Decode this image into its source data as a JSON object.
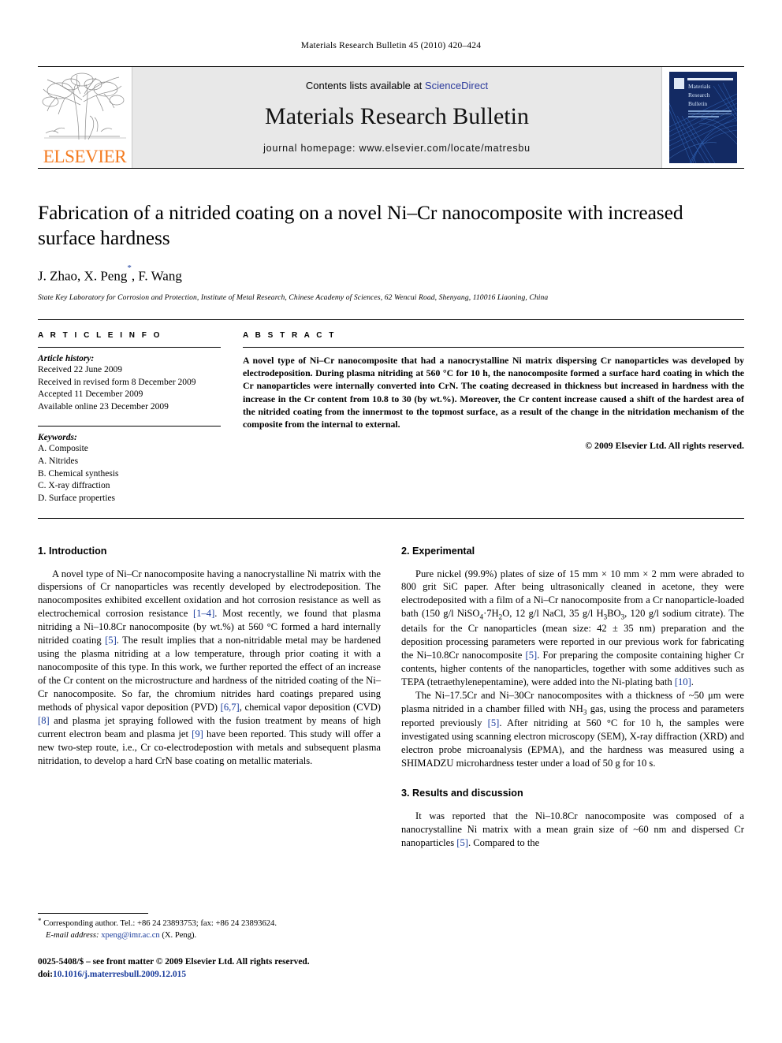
{
  "running_head": "Materials Research Bulletin 45 (2010) 420–424",
  "masthead": {
    "publisher_name": "ELSEVIER",
    "contents_prefix": "Contents lists available at ",
    "contents_link": "ScienceDirect",
    "journal_title": "Materials Research Bulletin",
    "homepage": "journal homepage: www.elsevier.com/locate/matresbu",
    "cover": {
      "line1": "Materials",
      "line2": "Research",
      "line3": "Bulletin"
    },
    "link_color": "#2b3a9c",
    "brand_color": "#F47B20"
  },
  "article": {
    "title": "Fabrication of a nitrided coating on a novel Ni–Cr nanocomposite with increased surface hardness",
    "authors_pre": "J. Zhao, X. Peng",
    "authors_star": "*",
    "authors_post": ", F. Wang",
    "affiliation": "State Key Laboratory for Corrosion and Protection, Institute of Metal Research, Chinese Academy of Sciences, 62 Wencui Road, Shenyang, 110016 Liaoning, China"
  },
  "info": {
    "heading": "A R T I C L E   I N F O",
    "history_title": "Article history:",
    "history": [
      "Received 22 June 2009",
      "Received in revised form 8 December 2009",
      "Accepted 11 December 2009",
      "Available online 23 December 2009"
    ],
    "keywords_title": "Keywords:",
    "keywords": [
      "A. Composite",
      "A. Nitrides",
      "B. Chemical synthesis",
      "C. X-ray diffraction",
      "D. Surface properties"
    ]
  },
  "abstract": {
    "heading": "A B S T R A C T",
    "text": "A novel type of Ni–Cr nanocomposite that had a nanocrystalline Ni matrix dispersing Cr nanoparticles was developed by electrodeposition. During plasma nitriding at 560 °C for 10 h, the nanocomposite formed a surface hard coating in which the Cr nanoparticles were internally converted into CrN. The coating decreased in thickness but increased in hardness with the increase in the Cr content from 10.8 to 30 (by wt.%). Moreover, the Cr content increase caused a shift of the hardest area of the nitrided coating from the innermost to the topmost surface, as a result of the change in the nitridation mechanism of the composite from the internal to external.",
    "copyright": "© 2009 Elsevier Ltd. All rights reserved."
  },
  "sections": {
    "introduction": {
      "heading": "1. Introduction",
      "p1_a": "A novel type of Ni–Cr nanocomposite having a nanocrystalline Ni matrix with the dispersions of Cr nanoparticles was recently developed by electrodeposition. The nanocomposites exhibited excellent oxidation and hot corrosion resistance as well as electrochemical corrosion resistance ",
      "c1": "[1–4]",
      "p1_b": ". Most recently, we found that plasma nitriding a Ni–10.8Cr nanocomposite (by wt.%) at 560 °C formed a hard internally nitrided coating ",
      "c2": "[5]",
      "p1_c": ". The result implies that a non-nitridable metal may be hardened using the plasma nitriding at a low temperature, through prior coating it with a nanocomposite of this type. In this work, we further reported the effect of an increase of the Cr content on the microstructure and hardness of the nitrided coating of the Ni–Cr nanocomposite. So far, the chromium nitrides hard coatings prepared using methods of physical vapor deposition (PVD) ",
      "c3": "[6,7]",
      "p1_d": ", chemical vapor deposition (CVD) ",
      "c4": "[8]",
      "p1_e": " and plasma jet spraying followed with the fusion treatment by means of high current electron beam and plasma jet ",
      "c5": "[9]",
      "p1_f": " have been reported. This study will offer a new two-step route, i.e., Cr co-electrodepostion with metals and subsequent plasma nitridation, to develop a hard CrN base coating on metallic materials."
    },
    "experimental": {
      "heading": "2. Experimental",
      "p1_a": "Pure nickel (99.9%) plates of size of 15 mm × 10 mm × 2 mm were abraded to 800 grit SiC paper. After being ultrasonically cleaned in acetone, they were electrodeposited with a film of a Ni–Cr nanocomposite from a Cr nanoparticle-loaded bath (150 g/l NiSO",
      "sub1": "4",
      "p1_b": "·7H",
      "sub2": "2",
      "p1_c": "O, 12 g/l NaCl, 35 g/l H",
      "sub3": "3",
      "p1_d": "BO",
      "sub4": "3",
      "p1_e": ", 120 g/l sodium citrate). The details for the Cr nanoparticles (mean size: 42 ± 35 nm) preparation and the deposition processing parameters were reported in our previous work for fabricating the Ni–10.8Cr nanocomposite ",
      "c1": "[5]",
      "p1_f": ". For preparing the composite containing higher Cr contents, higher contents of the nanoparticles, together with some additives such as TEPA (tetraethylenepentamine), were added into the Ni-plating bath ",
      "c2": "[10]",
      "p1_g": ".",
      "p2_a": "The Ni–17.5Cr and Ni–30Cr nanocomposites with a thickness of ~50 μm were plasma nitrided in a chamber filled with NH",
      "sub5": "3",
      "p2_b": " gas, using the process and parameters reported previously ",
      "c3": "[5]",
      "p2_c": ". After nitriding at 560 °C for 10 h, the samples were investigated using scanning electron microscopy (SEM), X-ray diffraction (XRD) and electron probe microanalysis (EPMA), and the hardness was measured using a SHIMADZU microhardness tester under a load of 50 g for 10 s."
    },
    "results": {
      "heading": "3. Results and discussion",
      "p1_a": "It was reported that the Ni–10.8Cr nanocomposite was composed of a nanocrystalline Ni matrix with a mean grain size of ~60 nm and dispersed Cr nanoparticles ",
      "c1": "[5]",
      "p1_b": ". Compared to the"
    }
  },
  "footnote": {
    "star": "*",
    "text": " Corresponding author. Tel.: +86 24 23893753; fax: +86 24 23893624.",
    "email_label": "E-mail address:",
    "email": "xpeng@imr.ac.cn",
    "email_suffix": " (X. Peng)."
  },
  "footer": {
    "issn_line": "0025-5408/$ – see front matter © 2009 Elsevier Ltd. All rights reserved.",
    "doi_prefix": "doi:",
    "doi": "10.1016/j.materresbull.2009.12.015"
  }
}
